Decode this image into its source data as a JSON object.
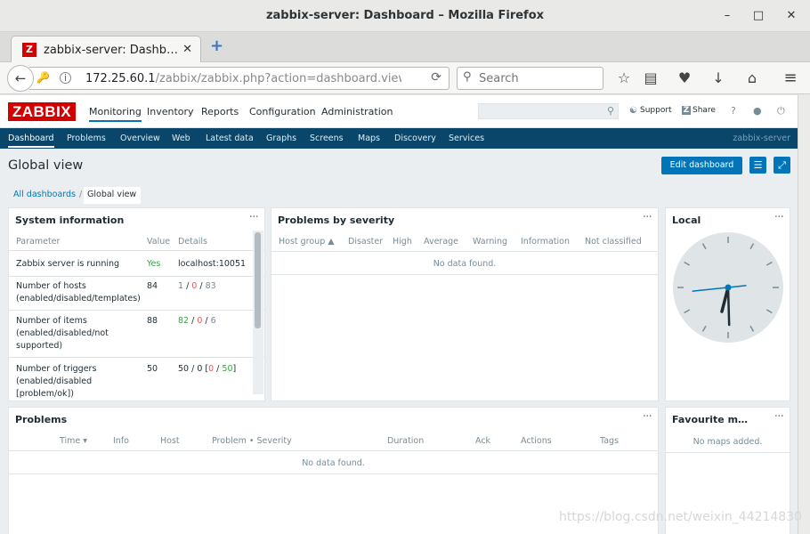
{
  "window": {
    "title": "zabbix-server: Dashboard – Mozilla Firefox",
    "minimize": "–",
    "maximize": "□",
    "close": "✕"
  },
  "tab": {
    "favicon": "Z",
    "title": "zabbix-server: Dashb…",
    "close": "✕",
    "new_tab": "+"
  },
  "navbar": {
    "url_host": "172.25.60.1",
    "url_path": "/zabbix/zabbix.php?action=dashboard.view",
    "search_placeholder": "Search"
  },
  "zabbix": {
    "logo": "ZABBIX",
    "menu": [
      "Monitoring",
      "Inventory",
      "Reports",
      "Configuration",
      "Administration"
    ],
    "support": "Support",
    "share": "Share",
    "help": "?",
    "submenu": [
      "Dashboard",
      "Problems",
      "Overview",
      "Web",
      "Latest data",
      "Graphs",
      "Screens",
      "Maps",
      "Discovery",
      "Services"
    ],
    "server_name": "zabbix-server"
  },
  "page": {
    "title": "Global view",
    "edit_dashboard": "Edit dashboard",
    "breadcrumb_all": "All dashboards",
    "breadcrumb_sep": "/",
    "breadcrumb_current": "Global view"
  },
  "system_info": {
    "title": "System information",
    "headers": {
      "parameter": "Parameter",
      "value": "Value",
      "details": "Details"
    },
    "rows": [
      {
        "param": [
          "Zabbix server is running"
        ],
        "value": "Yes",
        "d_a": "localhost:10051",
        "d_b": "",
        "d_c": ""
      },
      {
        "param": [
          "Number of hosts",
          "(enabled/disabled/templates)"
        ],
        "value": "84",
        "d_a": "1",
        "d_b": "0",
        "d_c": "83"
      },
      {
        "param": [
          "Number of items",
          "(enabled/disabled/not",
          "supported)"
        ],
        "value": "88",
        "d_a": "82",
        "d_b": "0",
        "d_c": "6"
      },
      {
        "param": [
          "Number of triggers",
          "(enabled/disabled",
          "[problem/ok])"
        ],
        "value": "50",
        "d_a": "50 / 0 [",
        "d_b": "0",
        "d_c": "50"
      }
    ]
  },
  "problems_by_severity": {
    "title": "Problems by severity",
    "headers": [
      "Host group ▲",
      "Disaster",
      "High",
      "Average",
      "Warning",
      "Information",
      "Not classified"
    ],
    "empty": "No data found."
  },
  "clock": {
    "title": "Local",
    "hour": 6,
    "minute": 29,
    "second": 44
  },
  "problems": {
    "title": "Problems",
    "headers": [
      "Time ▾",
      "Info",
      "Host",
      "Problem • Severity",
      "Duration",
      "Ack",
      "Actions",
      "Tags"
    ],
    "empty": "No data found."
  },
  "favourite_maps": {
    "title": "Favourite m…",
    "empty": "No maps added."
  },
  "watermark": "https://blog.csdn.net/weixin_44214830",
  "colors": {
    "accent": "#0275b8",
    "subnav": "#0a466a",
    "logo": "#d40000",
    "ok": "#429e47",
    "problem": "#e45959"
  }
}
